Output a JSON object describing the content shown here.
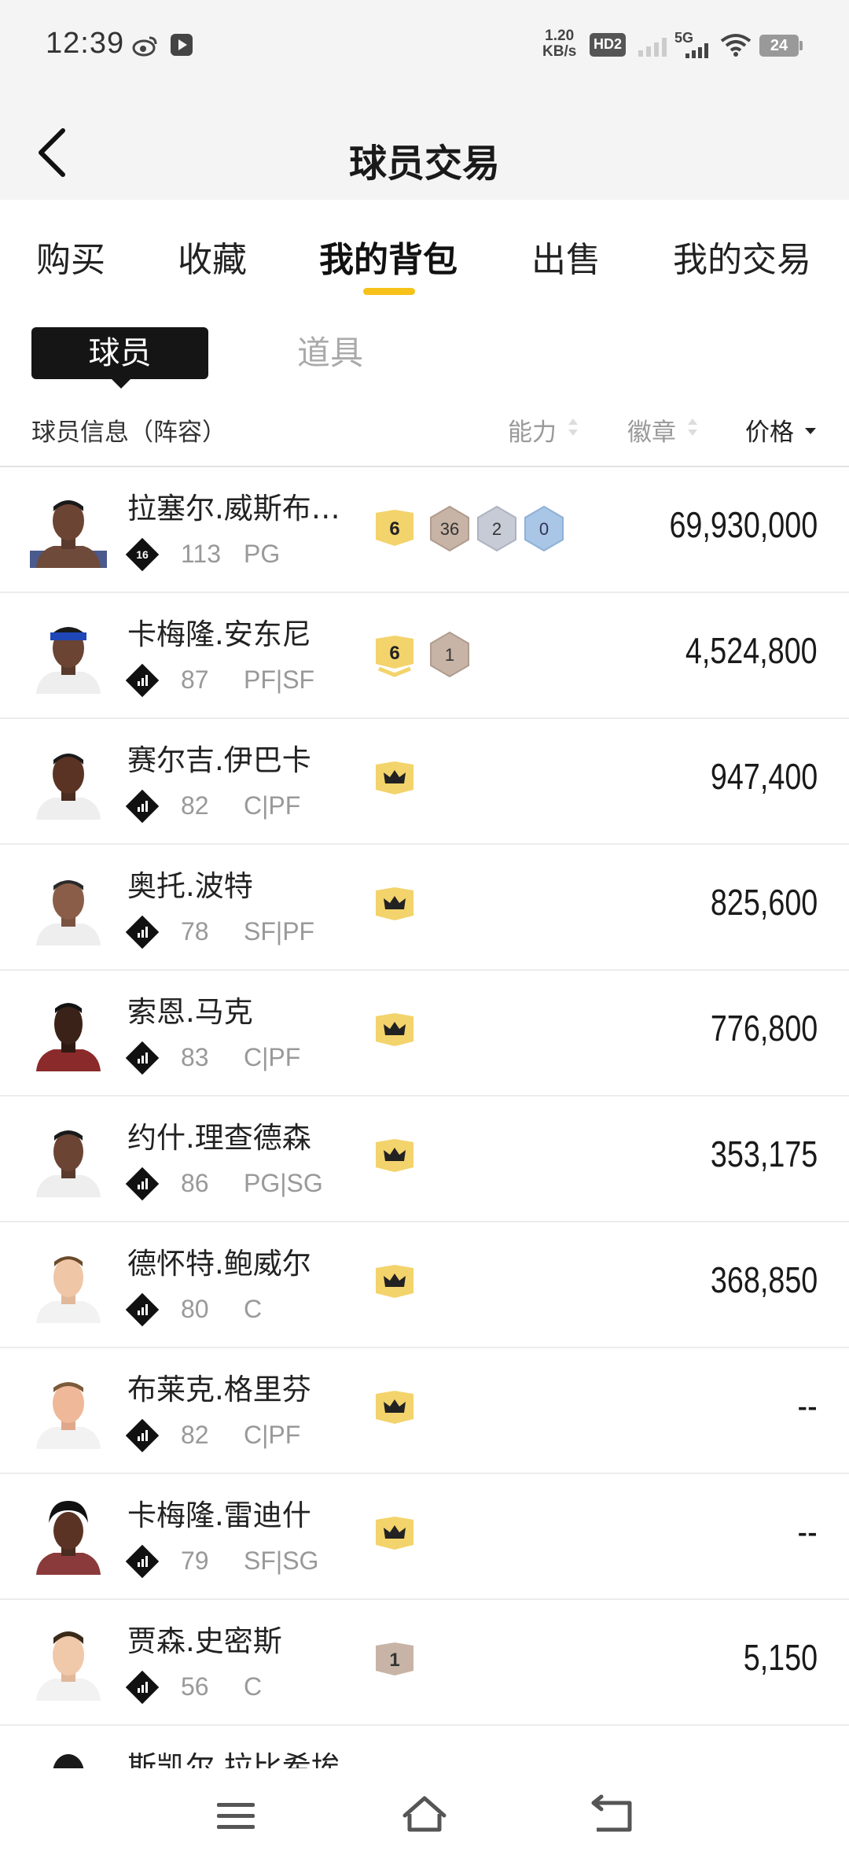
{
  "status_bar": {
    "time": "12:39",
    "speed_value": "1.20",
    "speed_unit": "KB/s",
    "hd_label": "HD2",
    "network": "5G",
    "battery": "24"
  },
  "header": {
    "title": "球员交易"
  },
  "main_tabs": [
    {
      "label": "购买",
      "active": false
    },
    {
      "label": "收藏",
      "active": false
    },
    {
      "label": "我的背包",
      "active": true
    },
    {
      "label": "出售",
      "active": false
    },
    {
      "label": "我的交易",
      "active": false
    }
  ],
  "sub_tabs": {
    "player": "球员",
    "items": "道具"
  },
  "columns": {
    "info": "球员信息（阵容）",
    "ability": "能力",
    "badge": "徽章",
    "price": "价格"
  },
  "players": [
    {
      "name": "拉塞尔.威斯布…",
      "ovr": "113",
      "pos": "PG",
      "price": "69,930,000",
      "tier": "16"
    },
    {
      "name": "卡梅隆.安东尼",
      "ovr": "87",
      "pos": "PF|SF",
      "price": "4,524,800"
    },
    {
      "name": "赛尔吉.伊巴卡",
      "ovr": "82",
      "pos": "C|PF",
      "price": "947,400"
    },
    {
      "name": "奥托.波特",
      "ovr": "78",
      "pos": "SF|PF",
      "price": "825,600"
    },
    {
      "name": "索恩.马克",
      "ovr": "83",
      "pos": "C|PF",
      "price": "776,800"
    },
    {
      "name": "约什.理查德森",
      "ovr": "86",
      "pos": "PG|SG",
      "price": "353,175"
    },
    {
      "name": "德怀特.鲍威尔",
      "ovr": "80",
      "pos": "C",
      "price": "368,850"
    },
    {
      "name": "布莱克.格里芬",
      "ovr": "82",
      "pos": "C|PF",
      "price": "--"
    },
    {
      "name": "卡梅隆.雷迪什",
      "ovr": "79",
      "pos": "SF|SG",
      "price": "--"
    },
    {
      "name": "贾森.史密斯",
      "ovr": "56",
      "pos": "C",
      "price": "5,150"
    },
    {
      "name": "斯凯尔.拉比希埃"
    }
  ],
  "badges": {
    "row0": {
      "ability": "6",
      "b1": "36",
      "b2": "2",
      "b3": "0"
    },
    "row1": {
      "ability": "6",
      "b1": "1"
    },
    "row9": {
      "ability": "1"
    }
  },
  "colors": {
    "accent_yellow": "#f6c21a",
    "badge_gold": "#f3d36b",
    "badge_bronze": "#c8b4a6",
    "badge_silver": "#c6cbd6",
    "badge_blue": "#a9c6e6",
    "tab_active_bg": "#151515"
  },
  "icons": {
    "back": "chevron-left-icon",
    "crown": "crown-icon",
    "tier": "diamond-tier-icon",
    "nav_menu": "menu-icon",
    "nav_home": "home-icon",
    "nav_back": "back-icon"
  }
}
